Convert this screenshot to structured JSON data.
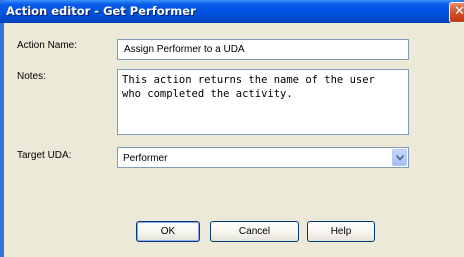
{
  "window": {
    "title": "Action editor - Get Performer",
    "close_glyph": "✕"
  },
  "form": {
    "action_name_label": "Action Name:",
    "action_name_value": "Assign Performer to a UDA",
    "notes_label": "Notes:",
    "notes_value": "This action returns the name of the user\nwho completed the activity.",
    "target_uda_label": "Target UDA:",
    "target_uda_value": "Performer"
  },
  "buttons": {
    "ok": "OK",
    "cancel": "Cancel",
    "help": "Help"
  },
  "icons": {
    "close": "close-icon",
    "dropdown": "chevron-down-icon"
  },
  "colors": {
    "titlebar": "#0054e3",
    "client_bg": "#ece9d8",
    "field_border": "#7f9db9",
    "close_button": "#d24b25"
  }
}
